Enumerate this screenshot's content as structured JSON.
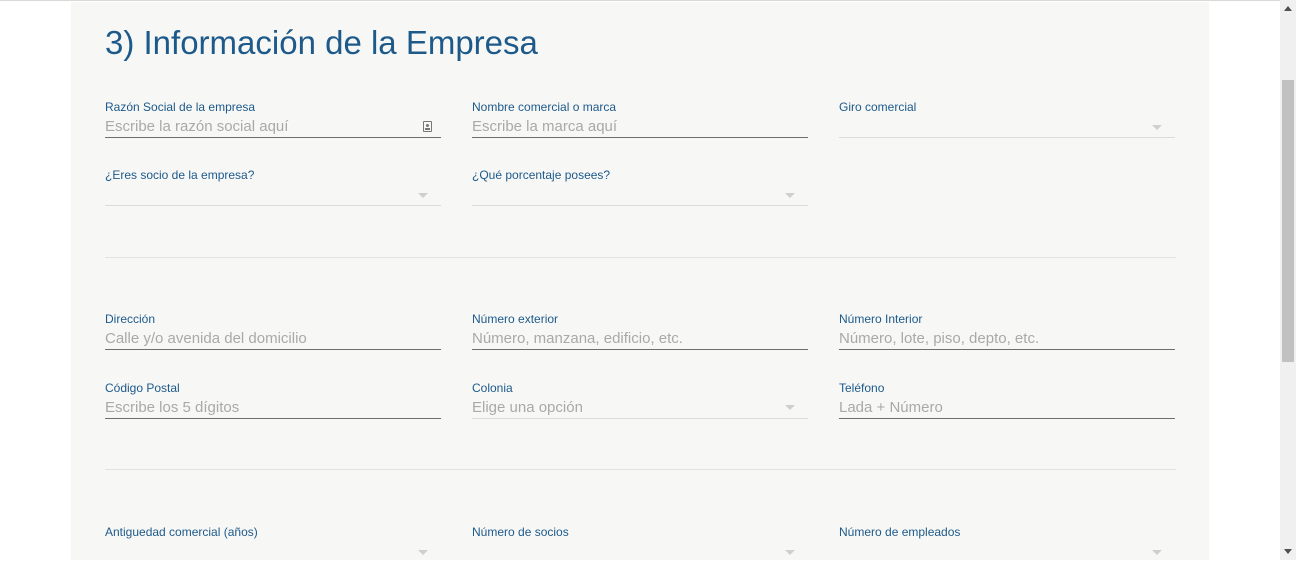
{
  "section": {
    "title": "3) Información de la Empresa"
  },
  "fields": {
    "razon_social": {
      "label": "Razón Social de la empresa",
      "placeholder": "Escribe la razón social aquí"
    },
    "nombre_comercial": {
      "label": "Nombre comercial o marca",
      "placeholder": "Escribe la marca aquí"
    },
    "giro_comercial": {
      "label": "Giro comercial",
      "value": ""
    },
    "eres_socio": {
      "label": "¿Eres socio de la empresa?",
      "value": ""
    },
    "porcentaje": {
      "label": "¿Qué porcentaje posees?",
      "value": ""
    },
    "direccion": {
      "label": "Dirección",
      "placeholder": "Calle y/o avenida del domicilio"
    },
    "numero_exterior": {
      "label": "Número exterior",
      "placeholder": "Número, manzana, edificio, etc."
    },
    "numero_interior": {
      "label": "Número Interior",
      "placeholder": "Número, lote, piso, depto, etc."
    },
    "codigo_postal": {
      "label": "Código Postal",
      "placeholder": "Escribe los 5 dígitos"
    },
    "colonia": {
      "label": "Colonia",
      "placeholder": "Elige una opción"
    },
    "telefono": {
      "label": "Teléfono",
      "placeholder": "Lada + Número"
    },
    "antiguedad": {
      "label": "Antiguedad comercial (años)",
      "value": ""
    },
    "numero_socios": {
      "label": "Número de socios",
      "value": ""
    },
    "numero_empleados": {
      "label": "Número de empleados",
      "value": ""
    }
  },
  "icons": {
    "razon_social_icon": "contact-card-icon",
    "dropdown_icon": "chevron-down-icon"
  },
  "colors": {
    "accent": "#1d5a8a",
    "placeholder": "#a9a9a9",
    "panel_background": "#f7f7f6"
  }
}
